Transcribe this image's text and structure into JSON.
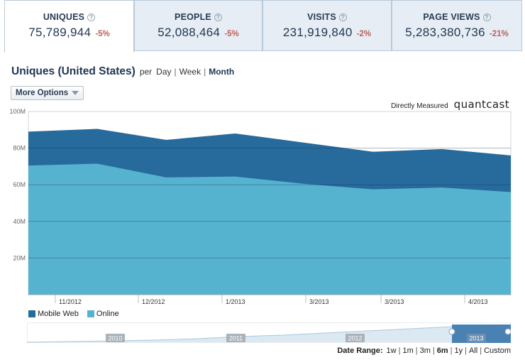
{
  "metrics": [
    {
      "label": "UNIQUES",
      "value": "75,789,944",
      "delta": "-5%",
      "active": true
    },
    {
      "label": "PEOPLE",
      "value": "52,088,464",
      "delta": "-5%",
      "active": false
    },
    {
      "label": "VISITS",
      "value": "231,919,840",
      "delta": "-2%",
      "active": false
    },
    {
      "label": "PAGE VIEWS",
      "value": "5,283,380,736",
      "delta": "-21%",
      "active": false
    }
  ],
  "header": {
    "title": "Uniques (United States)",
    "per": "per",
    "periods": [
      "Day",
      "Week",
      "Month"
    ],
    "selected_period": "Month",
    "more_options": "More Options",
    "measured_label": "Directly Measured",
    "brand": "quantcast"
  },
  "chart_data": {
    "type": "area",
    "stacked": true,
    "x": [
      "11/2012 (early)",
      "11/2012",
      "12/2012",
      "1/2013",
      "3/2013",
      "3/2013",
      "4/2013",
      "4/2013 (late)"
    ],
    "xticks": [
      "11/2012",
      "12/2012",
      "1/2013",
      "3/2013",
      "3/2013",
      "4/2013"
    ],
    "ylim": [
      0,
      100
    ],
    "yticks": [
      "100M",
      "80M",
      "60M",
      "40M",
      "20M"
    ],
    "ytick_values": [
      100,
      80,
      60,
      40,
      20
    ],
    "series": [
      {
        "name": "Online",
        "color": "#56b3cf",
        "values": [
          70.5,
          71.5,
          64,
          64.5,
          60.5,
          57.5,
          58.5,
          56
        ]
      },
      {
        "name": "Mobile Web",
        "color": "#276a9c",
        "values": [
          18.5,
          19,
          20.5,
          23.5,
          22.5,
          20.5,
          21,
          20
        ]
      }
    ],
    "grid": true
  },
  "legend": [
    {
      "label": "Mobile Web",
      "color": "#276a9c"
    },
    {
      "label": "Online",
      "color": "#56b3cf"
    }
  ],
  "navigator": {
    "years": [
      "2010",
      "2011",
      "2012",
      "2013"
    ]
  },
  "date_range": {
    "label": "Date Range:",
    "options": [
      "1w",
      "1m",
      "3m",
      "6m",
      "1y",
      "All",
      "Custom"
    ],
    "selected": "6m"
  }
}
